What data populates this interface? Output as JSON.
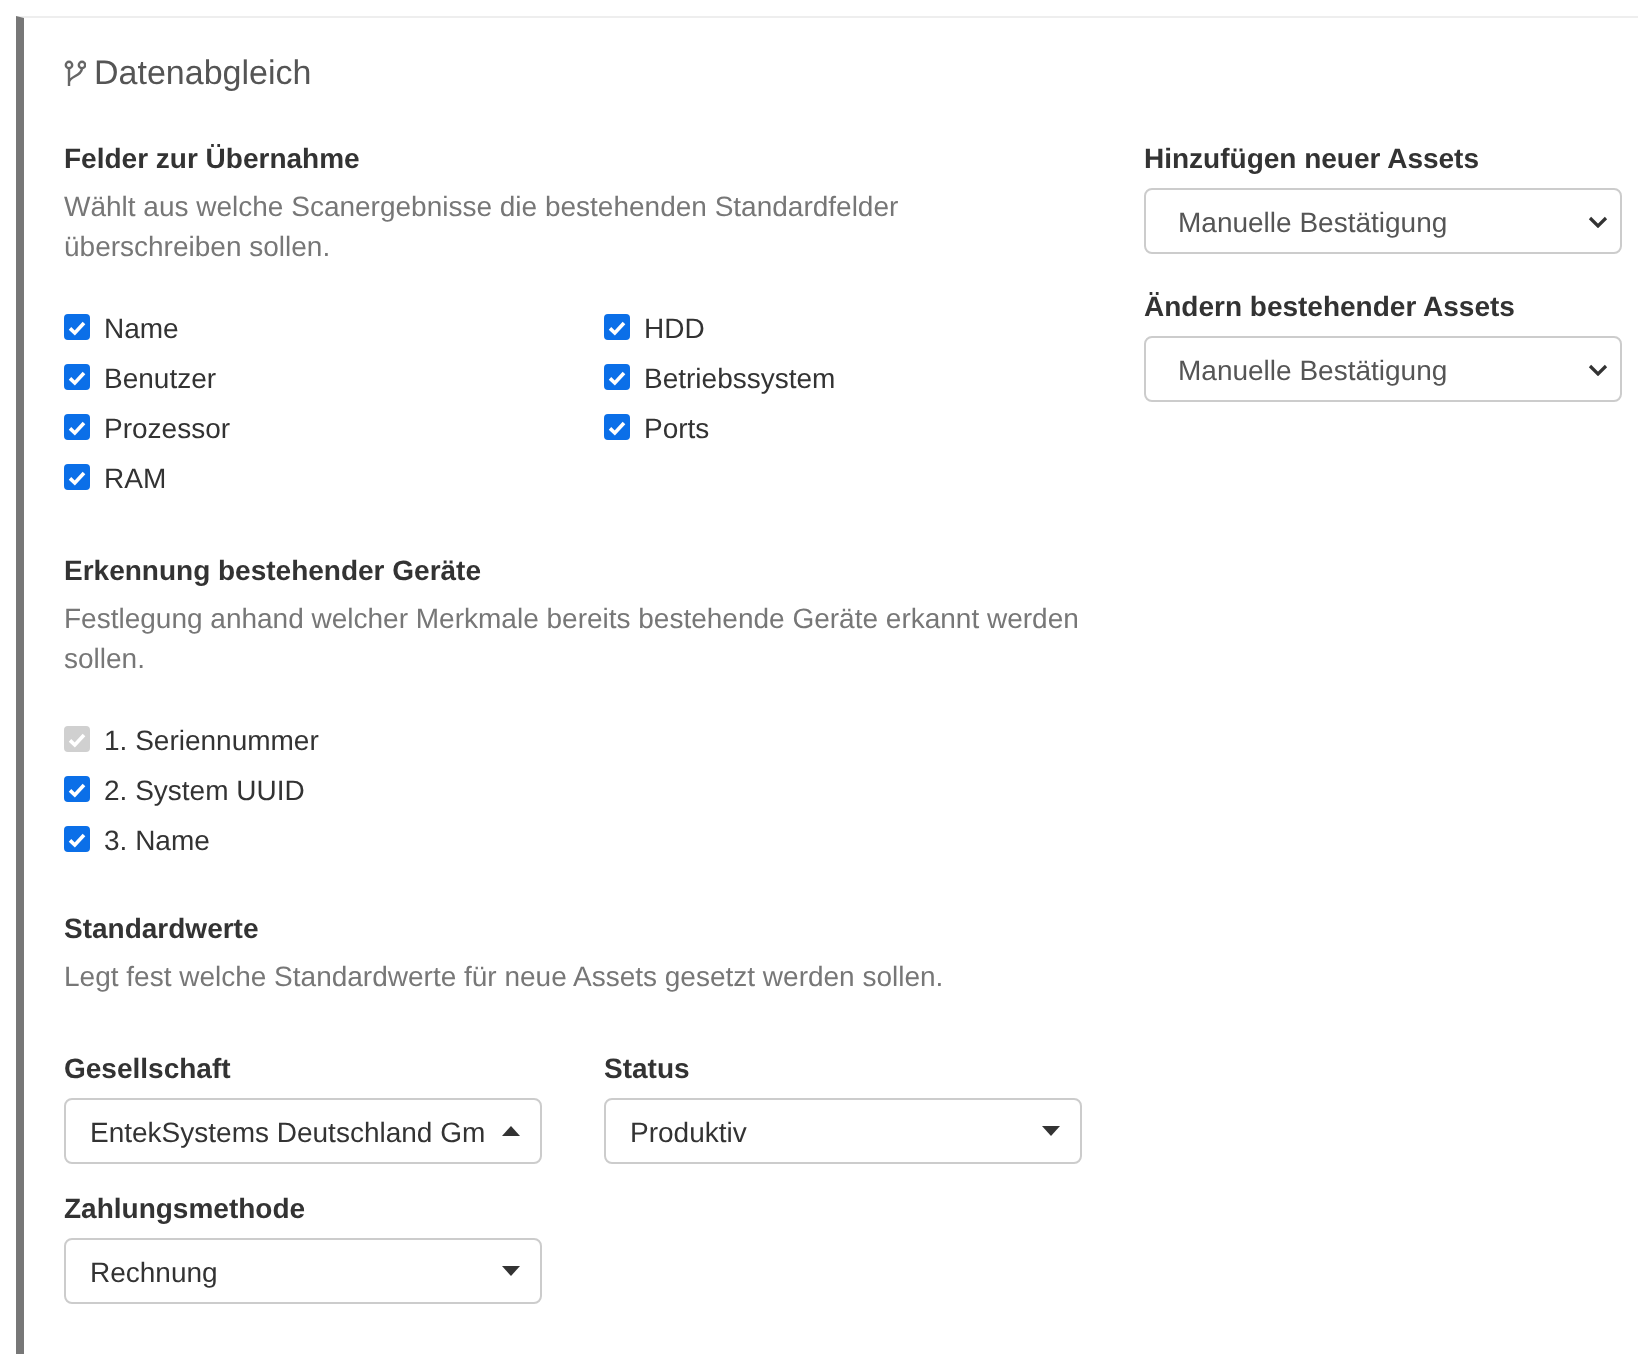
{
  "panel": {
    "title": "Datenabgleich"
  },
  "fields_section": {
    "heading": "Felder zur Übernahme",
    "description": "Wählt aus welche Scanergebnisse die bestehenden Standardfelder überschreiben sollen.",
    "columns": [
      [
        {
          "label": "Name",
          "checked": true,
          "disabled": false
        },
        {
          "label": "Benutzer",
          "checked": true,
          "disabled": false
        },
        {
          "label": "Prozessor",
          "checked": true,
          "disabled": false
        },
        {
          "label": "RAM",
          "checked": true,
          "disabled": false
        }
      ],
      [
        {
          "label": "HDD",
          "checked": true,
          "disabled": false
        },
        {
          "label": "Betriebssystem",
          "checked": true,
          "disabled": false
        },
        {
          "label": "Ports",
          "checked": true,
          "disabled": false
        }
      ]
    ]
  },
  "recognition_section": {
    "heading": "Erkennung bestehender Geräte",
    "description": "Festlegung anhand welcher Merkmale bereits bestehende Geräte erkannt werden sollen.",
    "items": [
      {
        "label": "1. Seriennummer",
        "checked": true,
        "disabled": true
      },
      {
        "label": "2. System UUID",
        "checked": true,
        "disabled": false
      },
      {
        "label": "3. Name",
        "checked": true,
        "disabled": false
      }
    ]
  },
  "defaults_section": {
    "heading": "Standardwerte",
    "description": "Legt fest welche Standardwerte für neue Assets gesetzt werden sollen.",
    "fields": [
      {
        "label": "Gesellschaft",
        "value": "EntekSystems Deutschland Gm",
        "expanded": true
      },
      {
        "label": "Status",
        "value": "Produktiv",
        "expanded": false
      },
      {
        "label": "Zahlungsmethode",
        "value": "Rechnung",
        "expanded": false
      }
    ]
  },
  "side_settings": [
    {
      "label": "Hinzufügen neuer Assets",
      "value": "Manuelle Bestätigung"
    },
    {
      "label": "Ändern bestehender Assets",
      "value": "Manuelle Bestätigung"
    }
  ]
}
